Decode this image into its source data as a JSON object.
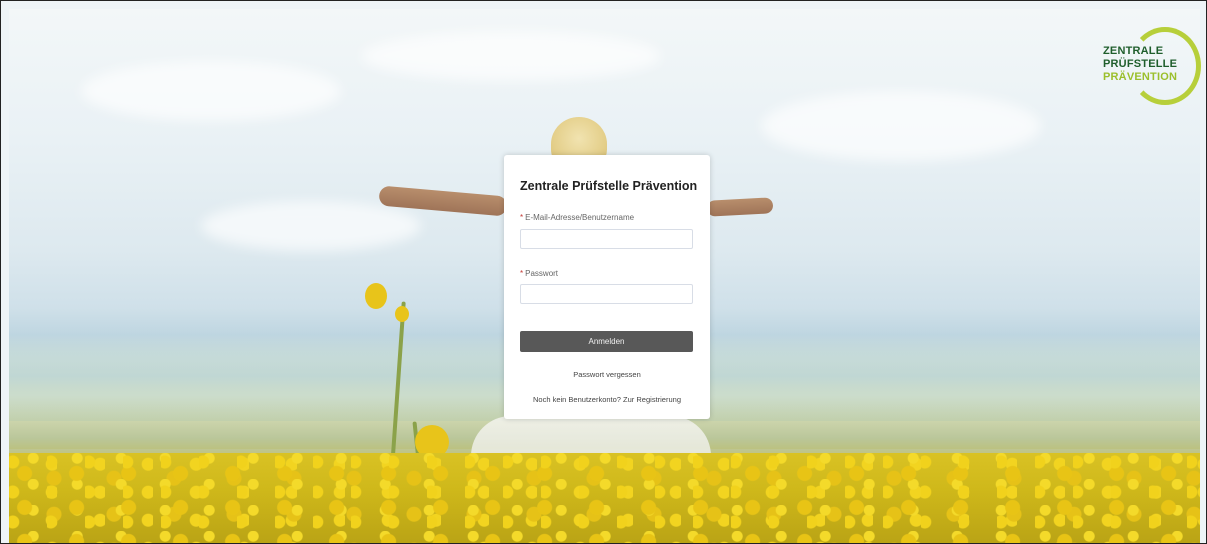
{
  "logo": {
    "line1": "ZENTRALE",
    "line2": "PRÜFSTELLE",
    "line3": "PRÄVENTION"
  },
  "login": {
    "title": "Zentrale Prüfstelle Prävention",
    "required_marker": "*",
    "username_label": "E-Mail-Adresse/Benutzername",
    "username_value": "",
    "password_label": "Passwort",
    "password_value": "",
    "submit_label": "Anmelden",
    "forgot_password_link": "Passwort vergessen",
    "register_link": "Noch kein Benutzerkonto? Zur Registrierung"
  },
  "colors": {
    "button_bg": "#585858",
    "required": "#c23934",
    "logo_dark_green": "#1f5e2c",
    "logo_light_green": "#9bbf2b"
  }
}
